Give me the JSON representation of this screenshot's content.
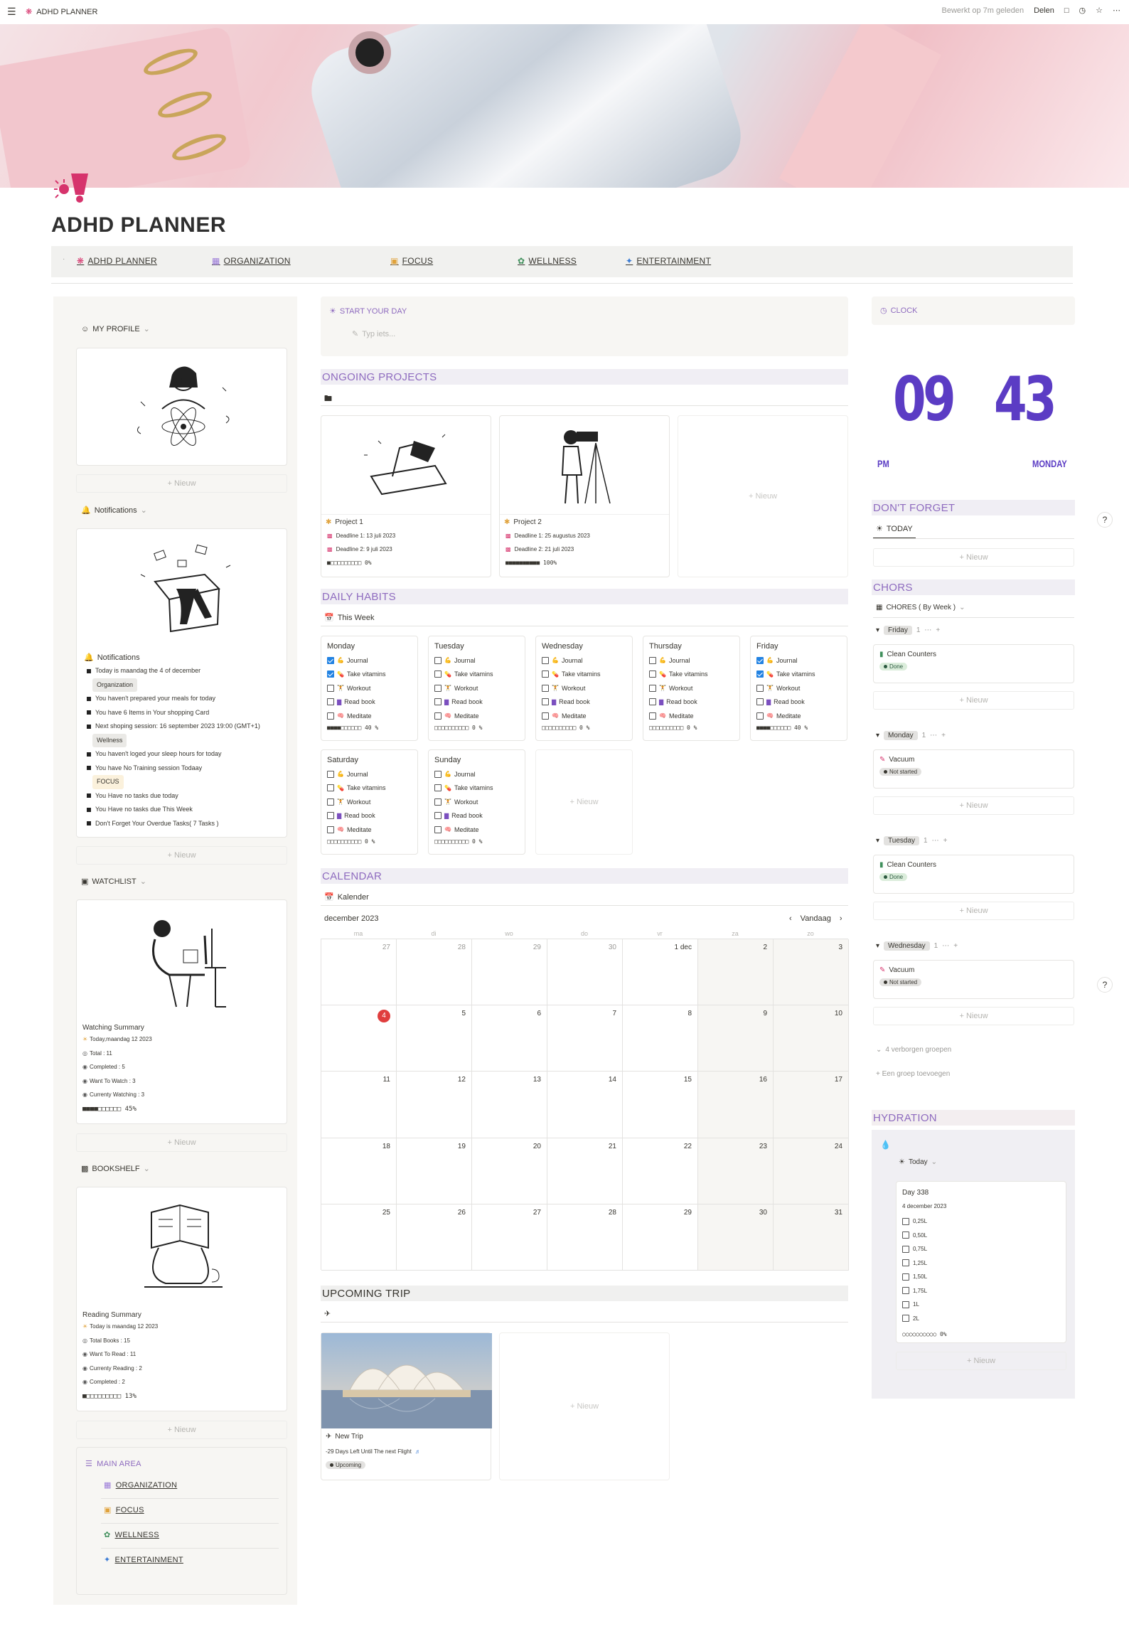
{
  "topbar": {
    "app_title": "ADHD PLANNER",
    "edited": "Bewerkt op 7m geleden",
    "share": "Delen"
  },
  "page": {
    "title": "ADHD PLANNER"
  },
  "nav": [
    {
      "label": "ADHD PLANNER",
      "icon": "brain-icon"
    },
    {
      "label": "ORGANIZATION",
      "icon": "grid-icon"
    },
    {
      "label": "FOCUS",
      "icon": "focus-icon"
    },
    {
      "label": "WELLNESS",
      "icon": "leaf-icon"
    },
    {
      "label": "ENTERTAINMENT",
      "icon": "party-icon"
    }
  ],
  "left": {
    "profile": {
      "label": "MY PROFILE"
    },
    "new": "+ Nieuw",
    "notifications": {
      "label": "Notifications",
      "title": "Notifications",
      "lines": [
        {
          "text": "Today is maandag the 4 of december"
        },
        {
          "tag": "Organization",
          "tagstyle": "gray"
        },
        {
          "text": "You haven't prepared your meals for today"
        },
        {
          "text": "You have 6 Items in Your shopping Card"
        },
        {
          "text": "Next shoping session: 16 september 2023 19:00 (GMT+1)"
        },
        {
          "tag": "Wellness",
          "tagstyle": "gray"
        },
        {
          "text": "You haven't loged your sleep hours for today"
        },
        {
          "text": "You have No Training session Todaay"
        },
        {
          "tag": "FOCUS",
          "tagstyle": "yel"
        },
        {
          "text": "You Have no tasks due today"
        },
        {
          "text": "You Have no tasks due This Week"
        },
        {
          "text": "Don't Forget Your Overdue Tasks( 7 Tasks )"
        }
      ]
    },
    "watchlist": {
      "label": "WATCHLIST",
      "title": "Watching Summary",
      "lines": [
        "Today,maandag 12 2023",
        "Total : 11",
        "Completed : 5",
        "Want To Watch : 3",
        "Currenty Watching : 3",
        "■■■■□□□□□□ 45%"
      ]
    },
    "bookshelf": {
      "label": "BOOKSHELF",
      "title": "Reading Summary",
      "lines": [
        "Today is maandag 12 2023",
        "Total Books : 15",
        "Want To Read : 11",
        "Currenty Reading : 2",
        "Completed : 2",
        "■□□□□□□□□□ 13%"
      ]
    },
    "main_area": {
      "title": "MAIN AREA",
      "items": [
        {
          "label": "ORGANIZATION",
          "icon": "grid-icon"
        },
        {
          "label": "FOCUS",
          "icon": "focus-icon"
        },
        {
          "label": "WELLNESS",
          "icon": "leaf-icon"
        },
        {
          "label": "ENTERTAINMENT",
          "icon": "party-icon"
        }
      ]
    }
  },
  "center": {
    "start": {
      "label": "START YOUR DAY",
      "placeholder": "Typ iets..."
    },
    "projects": {
      "title": "ONGOING PROJECTS",
      "items": [
        {
          "name": "Project 1",
          "deadline1": "Deadline 1: 13 juli 2023",
          "deadline2": "Deadline 2: 9 juli 2023",
          "progress": "■□□□□□□□□□ 0%"
        },
        {
          "name": "Project 2",
          "deadline1": "Deadline 1: 25 augustus 2023",
          "deadline2": "Deadline 2: 21 juli 2023",
          "progress": "■■■■■■■■■■ 100%"
        }
      ],
      "new": "+ Nieuw"
    },
    "habits": {
      "title": "DAILY HABITS",
      "view": "This Week",
      "tasks": [
        "Journal",
        "Take vitamins",
        "Workout",
        "Read book",
        "Meditate"
      ],
      "days": [
        {
          "day": "Monday",
          "checks": [
            true,
            true,
            false,
            false,
            false
          ],
          "progress": "■■■■□□□□□□ 40 %"
        },
        {
          "day": "Tuesday",
          "checks": [
            false,
            false,
            false,
            false,
            false
          ],
          "progress": "□□□□□□□□□□ 0 %"
        },
        {
          "day": "Wednesday",
          "checks": [
            false,
            false,
            false,
            false,
            false
          ],
          "progress": "□□□□□□□□□□ 0 %"
        },
        {
          "day": "Thursday",
          "checks": [
            false,
            false,
            false,
            false,
            false
          ],
          "progress": "□□□□□□□□□□ 0 %"
        },
        {
          "day": "Friday",
          "checks": [
            true,
            true,
            false,
            false,
            false
          ],
          "progress": "■■■■□□□□□□ 40 %"
        },
        {
          "day": "Saturday",
          "checks": [
            false,
            false,
            false,
            false,
            false
          ],
          "progress": "□□□□□□□□□□ 0 %"
        },
        {
          "day": "Sunday",
          "checks": [
            false,
            false,
            false,
            false,
            false
          ],
          "progress": "□□□□□□□□□□ 0 %"
        }
      ],
      "new": "+ Nieuw"
    },
    "calendar": {
      "title": "CALENDAR",
      "view": "Kalender",
      "month": "december 2023",
      "today_btn": "Vandaag",
      "weekdays": [
        "ma",
        "di",
        "wo",
        "do",
        "vr",
        "za",
        "zo"
      ],
      "weeks": [
        [
          "27",
          "28",
          "29",
          "30",
          "1 dec",
          "2",
          "3"
        ],
        [
          "4",
          "5",
          "6",
          "7",
          "8",
          "9",
          "10"
        ],
        [
          "11",
          "12",
          "13",
          "14",
          "15",
          "16",
          "17"
        ],
        [
          "18",
          "19",
          "20",
          "21",
          "22",
          "23",
          "24"
        ],
        [
          "25",
          "26",
          "27",
          "28",
          "29",
          "30",
          "31"
        ]
      ],
      "today": "4"
    },
    "trip": {
      "title": "UPCOMING TRIP",
      "name": "New Trip",
      "days_left": "-29 Days Left Until The next Flight",
      "status": "Upcoming",
      "new": "+ Nieuw"
    }
  },
  "right": {
    "clock": {
      "label": "CLOCK",
      "hour": "09",
      "minute": "43",
      "ampm": "PM",
      "weekday": "MONDAY"
    },
    "dont_forget": {
      "title": "DON'T FORGET",
      "view": "TODAY",
      "new": "+ Nieuw"
    },
    "chores": {
      "title": "CHORS",
      "view": "CHORES ( By Week )",
      "groups": [
        {
          "day": "Friday",
          "count": "1",
          "task": "Clean Counters",
          "status": "Done"
        },
        {
          "day": "Monday",
          "count": "1",
          "task": "Vacuum",
          "status": "Not started"
        },
        {
          "day": "Tuesday",
          "count": "1",
          "task": "Clean Counters",
          "status": "Done"
        },
        {
          "day": "Wednesday",
          "count": "1",
          "task": "Vacuum",
          "status": "Not started"
        }
      ],
      "new": "+ Nieuw",
      "hidden": "4 verborgen groepen",
      "add_group": "+ Een groep toevoegen"
    },
    "hydration": {
      "title": "HYDRATION",
      "view": "Today",
      "day": "Day 338",
      "date": "4 december 2023",
      "amounts": [
        "0,25L",
        "0,50L",
        "0,75L",
        "1,25L",
        "1,50L",
        "1,75L",
        "1L",
        "2L"
      ],
      "progress": "○○○○○○○○○○ 0%",
      "new": "+ Nieuw"
    }
  },
  "colors": {
    "accent": "#8e6bbf",
    "clock": "#5b3cc4",
    "pink": "#d6336c"
  }
}
